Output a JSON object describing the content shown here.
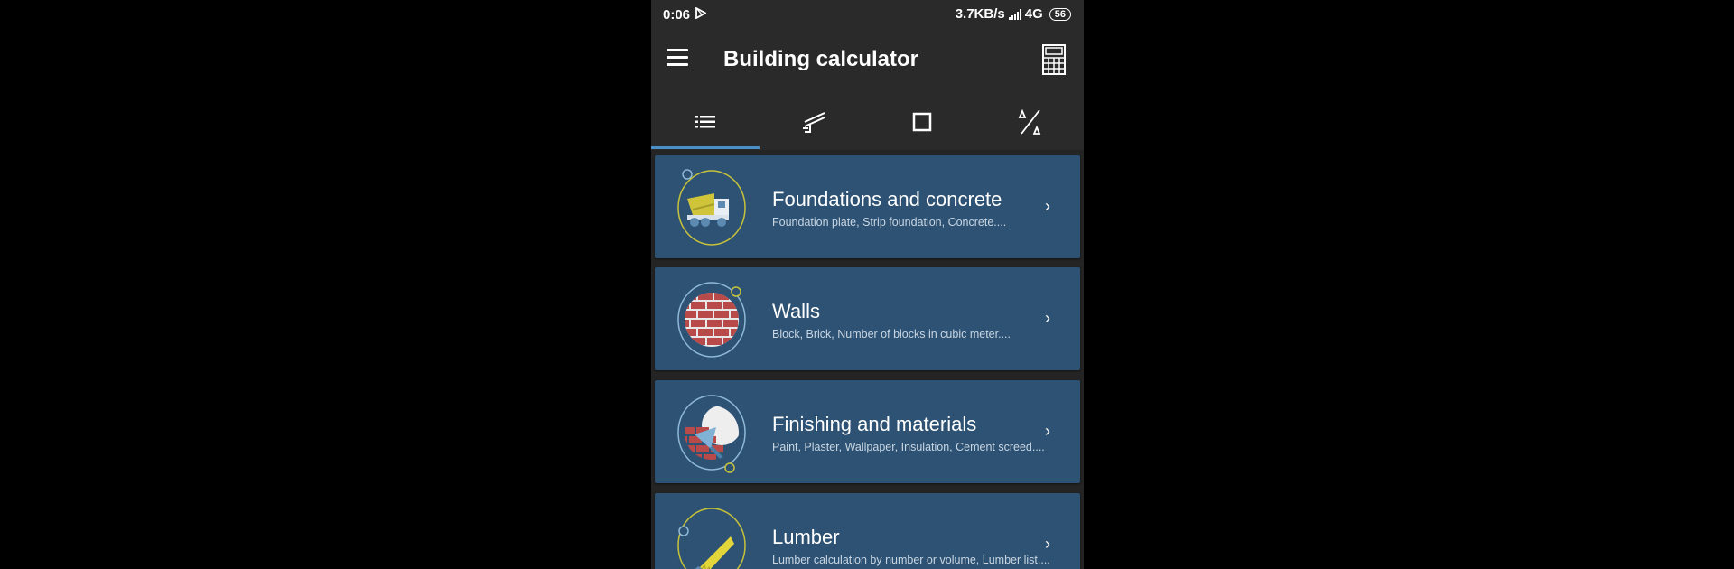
{
  "status": {
    "time": "0:06",
    "network_speed": "3.7KB/s",
    "network_type": "4G",
    "battery": "56"
  },
  "app": {
    "title": "Building calculator"
  },
  "tabs": [
    {
      "icon": "list-icon",
      "selected": true
    },
    {
      "icon": "trowel-icon",
      "selected": false
    },
    {
      "icon": "square-icon",
      "selected": false
    },
    {
      "icon": "triangle-ruler-icon",
      "selected": false
    }
  ],
  "categories": [
    {
      "title": "Foundations and concrete",
      "subtitle": "Foundation plate, Strip foundation, Concrete....",
      "icon": "concrete-mixer-icon"
    },
    {
      "title": "Walls",
      "subtitle": "Block, Brick, Number of blocks in cubic meter....",
      "icon": "brick-wall-icon"
    },
    {
      "title": "Finishing and materials",
      "subtitle": "Paint, Plaster, Wallpaper, Insulation, Cement screed....",
      "icon": "trowel-wall-icon"
    },
    {
      "title": "Lumber",
      "subtitle": "Lumber calculation by number or volume, Lumber list....",
      "icon": "saw-icon"
    }
  ],
  "colors": {
    "card_bg": "#2e5273",
    "app_bg": "#2a2a2a",
    "accent": "#4a90c8",
    "icon_ring": "#c7c23a"
  }
}
